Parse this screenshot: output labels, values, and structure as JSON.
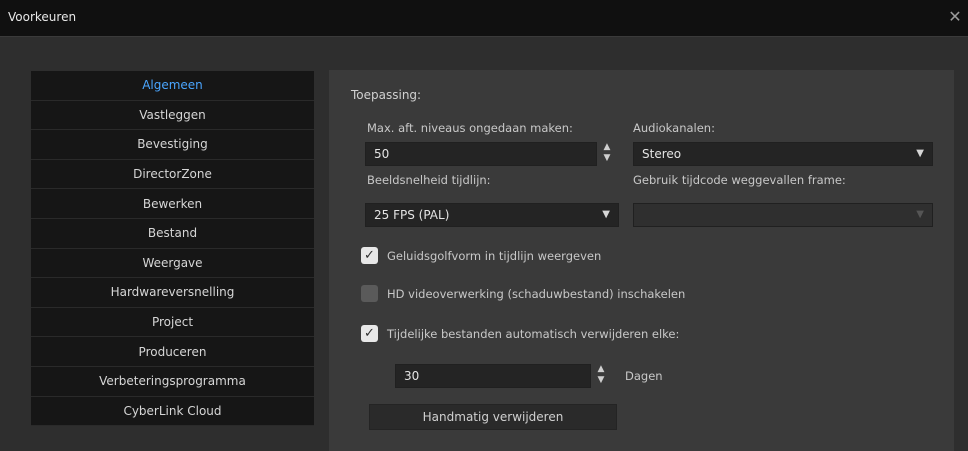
{
  "window": {
    "title": "Voorkeuren",
    "close_glyph": "✕"
  },
  "sidebar": {
    "items": [
      {
        "label": "Algemeen"
      },
      {
        "label": "Vastleggen"
      },
      {
        "label": "Bevestiging"
      },
      {
        "label": "DirectorZone"
      },
      {
        "label": "Bewerken"
      },
      {
        "label": "Bestand"
      },
      {
        "label": "Weergave"
      },
      {
        "label": "Hardwareversnelling"
      },
      {
        "label": "Project"
      },
      {
        "label": "Produceren"
      },
      {
        "label": "Verbeteringsprogramma"
      },
      {
        "label": "CyberLink Cloud"
      }
    ],
    "active_index": 0,
    "accent_color": "#4aa6ff"
  },
  "panel": {
    "section": "Toepassing:",
    "undo": {
      "label": "Max. aft. niveaus ongedaan maken:",
      "value": "50"
    },
    "audio": {
      "label": "Audiokanalen:",
      "value": "Stereo"
    },
    "fps": {
      "label": "Beeldsnelheid tijdlijn:",
      "value": "25 FPS (PAL)"
    },
    "dropframe": {
      "label": "Gebruik tijdcode weggevallen frame:",
      "value": ""
    },
    "checkboxes": [
      {
        "label": "Geluidsgolfvorm in tijdlijn weergeven",
        "checked": true
      },
      {
        "label": "HD videoverwerking (schaduwbestand) inschakelen",
        "checked": false
      },
      {
        "label": "Tijdelijke bestanden automatisch verwijderen elke:",
        "checked": true
      }
    ],
    "days": {
      "value": "30",
      "unit": "Dagen"
    },
    "manual_delete_button": "Handmatig verwijderen",
    "icons": {
      "dropdown": "chevron-down-icon",
      "spinner": "spinner-arrows-icon",
      "check": "checkmark-icon"
    }
  }
}
